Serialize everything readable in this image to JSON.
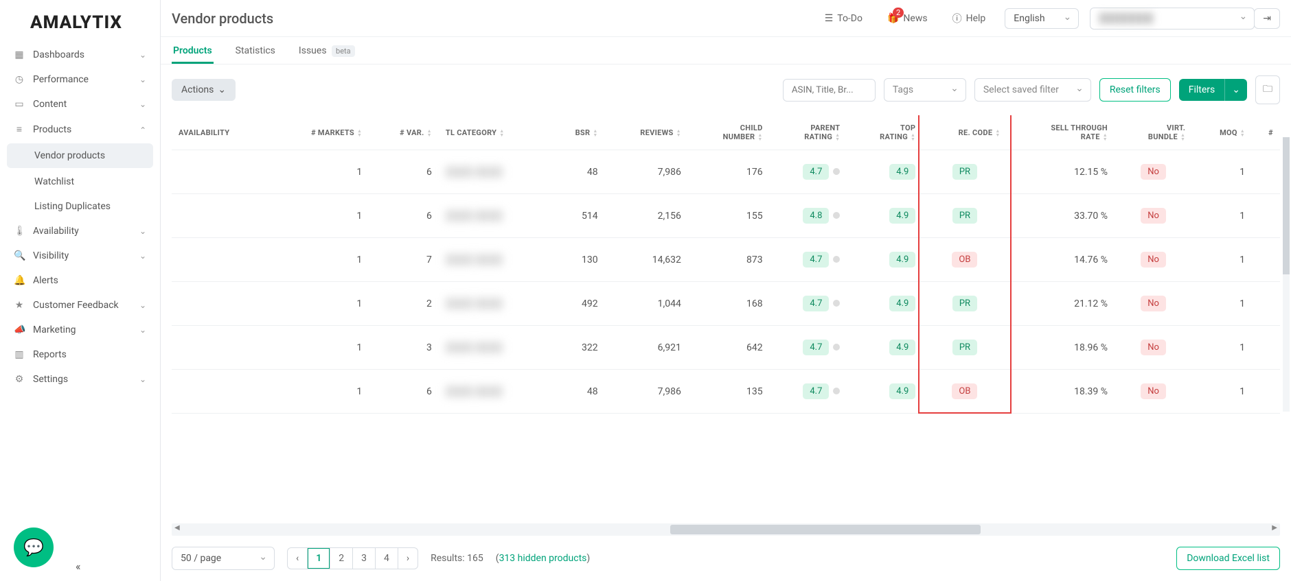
{
  "logo": "AMALYTIX",
  "nav": {
    "dashboards": "Dashboards",
    "performance": "Performance",
    "content": "Content",
    "products": "Products",
    "vendor_products": "Vendor products",
    "watchlist": "Watchlist",
    "listing_duplicates": "Listing Duplicates",
    "availability": "Availability",
    "visibility": "Visibility",
    "alerts": "Alerts",
    "customer_feedback": "Customer Feedback",
    "marketing": "Marketing",
    "reports": "Reports",
    "settings": "Settings"
  },
  "header": {
    "page_title": "Vendor products",
    "todo": "To-Do",
    "news": "News",
    "news_badge": "2",
    "help": "Help",
    "language": "English"
  },
  "tabs": {
    "products": "Products",
    "statistics": "Statistics",
    "issues": "Issues",
    "beta": "beta"
  },
  "toolbar": {
    "actions": "Actions",
    "search_placeholder": "ASIN, Title, Br...",
    "tags_placeholder": "Tags",
    "saved_filter_placeholder": "Select saved filter",
    "reset_filters": "Reset filters",
    "filters": "Filters"
  },
  "columns": {
    "availability": "AVAILABILITY",
    "markets": "# MARKETS",
    "var": "# VAR.",
    "tl_category": "TL CATEGORY",
    "bsr": "BSR",
    "reviews": "REVIEWS",
    "child_number": "CHILD NUMBER",
    "parent_rating": "PARENT RATING",
    "top_rating": "TOP RATING",
    "re_code": "RE. CODE",
    "sell_through": "SELL THROUGH RATE",
    "virt_bundle": "VIRT. BUNDLE",
    "moq": "MOQ",
    "extra": "#"
  },
  "rows": [
    {
      "markets": "1",
      "var": "6",
      "bsr": "48",
      "reviews": "7,986",
      "child": "176",
      "parent": "4.7",
      "top": "4.9",
      "code": "PR",
      "code_style": "green",
      "sell": "12.15 %",
      "bundle": "No",
      "moq": "1"
    },
    {
      "markets": "1",
      "var": "6",
      "bsr": "514",
      "reviews": "2,156",
      "child": "155",
      "parent": "4.8",
      "top": "4.9",
      "code": "PR",
      "code_style": "green",
      "sell": "33.70 %",
      "bundle": "No",
      "moq": "1"
    },
    {
      "markets": "1",
      "var": "7",
      "bsr": "130",
      "reviews": "14,632",
      "child": "873",
      "parent": "4.7",
      "top": "4.9",
      "code": "OB",
      "code_style": "red",
      "sell": "14.76 %",
      "bundle": "No",
      "moq": "1"
    },
    {
      "markets": "1",
      "var": "2",
      "bsr": "492",
      "reviews": "1,044",
      "child": "168",
      "parent": "4.7",
      "top": "4.9",
      "code": "PR",
      "code_style": "green",
      "sell": "21.12 %",
      "bundle": "No",
      "moq": "1"
    },
    {
      "markets": "1",
      "var": "3",
      "bsr": "322",
      "reviews": "6,921",
      "child": "642",
      "parent": "4.7",
      "top": "4.9",
      "code": "PR",
      "code_style": "green",
      "sell": "18.96 %",
      "bundle": "No",
      "moq": "1"
    },
    {
      "markets": "1",
      "var": "6",
      "bsr": "48",
      "reviews": "7,986",
      "child": "135",
      "parent": "4.7",
      "top": "4.9",
      "code": "OB",
      "code_style": "red",
      "sell": "18.39 %",
      "bundle": "No",
      "moq": "1"
    }
  ],
  "footer": {
    "page_size": "50 / page",
    "pages": [
      "1",
      "2",
      "3",
      "4"
    ],
    "results_label": "Results:",
    "results_count": "165",
    "hidden_link": "313 hidden products",
    "download": "Download Excel list"
  }
}
